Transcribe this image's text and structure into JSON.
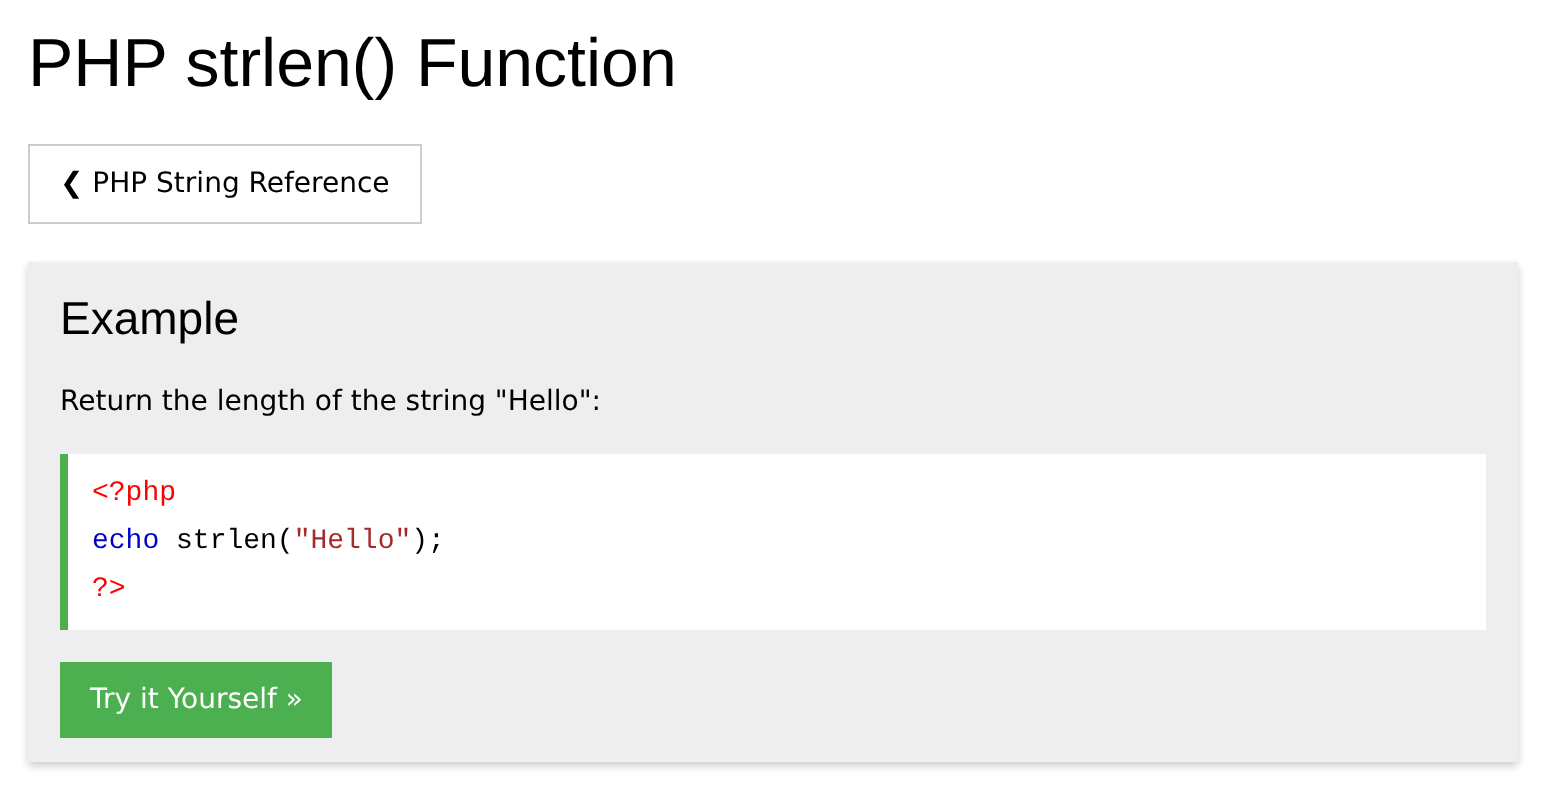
{
  "page_title": "PHP strlen() Function",
  "back_button": {
    "label": "❮ PHP String Reference"
  },
  "example": {
    "heading": "Example",
    "description": "Return the length of the string \"Hello\":",
    "code_lines": [
      [
        {
          "text": "<?php",
          "kind": "tag"
        }
      ],
      [
        {
          "text": "echo",
          "kind": "keyword"
        },
        {
          "text": " strlen(",
          "kind": "plain"
        },
        {
          "text": "\"Hello\"",
          "kind": "string"
        },
        {
          "text": ");",
          "kind": "plain"
        }
      ],
      [
        {
          "text": "?>",
          "kind": "tag"
        }
      ]
    ],
    "try_button": {
      "label": "Try it Yourself »"
    }
  }
}
